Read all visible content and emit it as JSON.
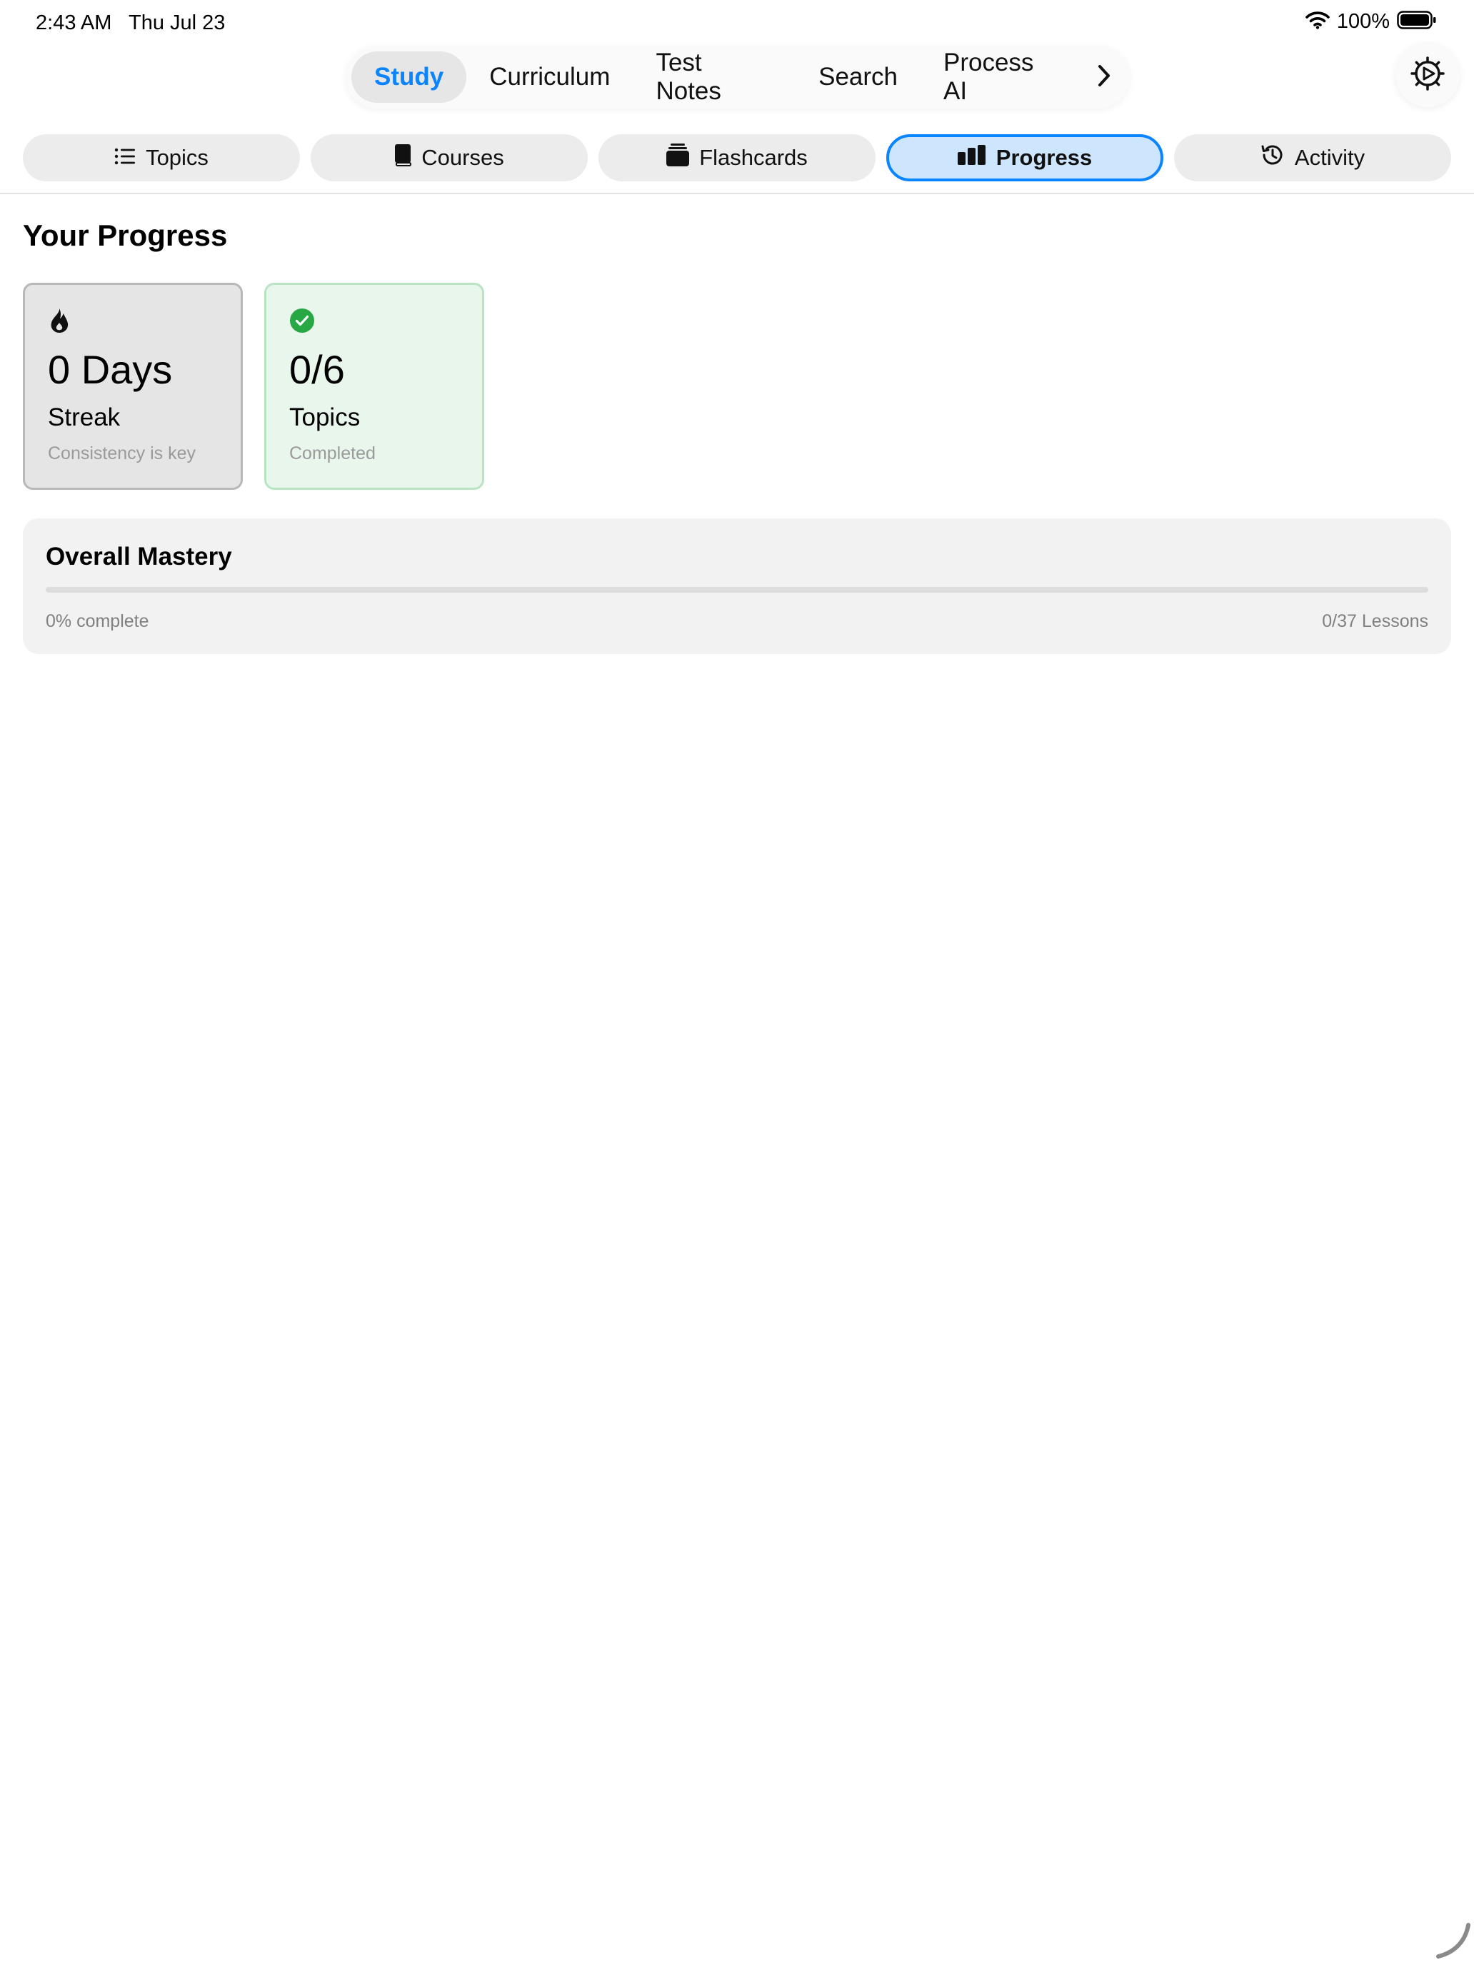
{
  "status_bar": {
    "time": "2:43 AM",
    "date": "Thu Jul 23",
    "battery_percent": "100%"
  },
  "top_nav": {
    "items": [
      {
        "label": "Study",
        "active": true
      },
      {
        "label": "Curriculum",
        "active": false
      },
      {
        "label": "Test Notes",
        "active": false
      },
      {
        "label": "Search",
        "active": false
      },
      {
        "label": "Process AI",
        "active": false
      }
    ],
    "more_icon": "chevron-right-icon",
    "settings_icon": "gear-icon"
  },
  "study_tabs": {
    "items": [
      {
        "label": "Topics",
        "icon": "list-icon",
        "active": false
      },
      {
        "label": "Courses",
        "icon": "book-icon",
        "active": false
      },
      {
        "label": "Flashcards",
        "icon": "cards-stack-icon",
        "active": false
      },
      {
        "label": "Progress",
        "icon": "bar-chart-icon",
        "active": true
      },
      {
        "label": "Activity",
        "icon": "history-clock-icon",
        "active": false
      }
    ]
  },
  "page_title": "Your Progress",
  "stats": {
    "streak": {
      "icon": "flame-icon",
      "value": "0 Days",
      "label": "Streak",
      "subtitle": "Consistency is key"
    },
    "topics": {
      "icon": "checkmark-circle-icon",
      "value": "0/6",
      "label": "Topics",
      "subtitle": "Completed"
    }
  },
  "mastery": {
    "title": "Overall Mastery",
    "progress_fraction": 0,
    "percent_text": "0% complete",
    "lessons_text": "0/37 Lessons"
  },
  "colors": {
    "accent": "#0b84ff",
    "active_tab_bg": "#cde6fd",
    "success": "#28a745",
    "topics_card_bg": "#e9f6ec",
    "streak_card_bg": "#e5e5e5"
  }
}
